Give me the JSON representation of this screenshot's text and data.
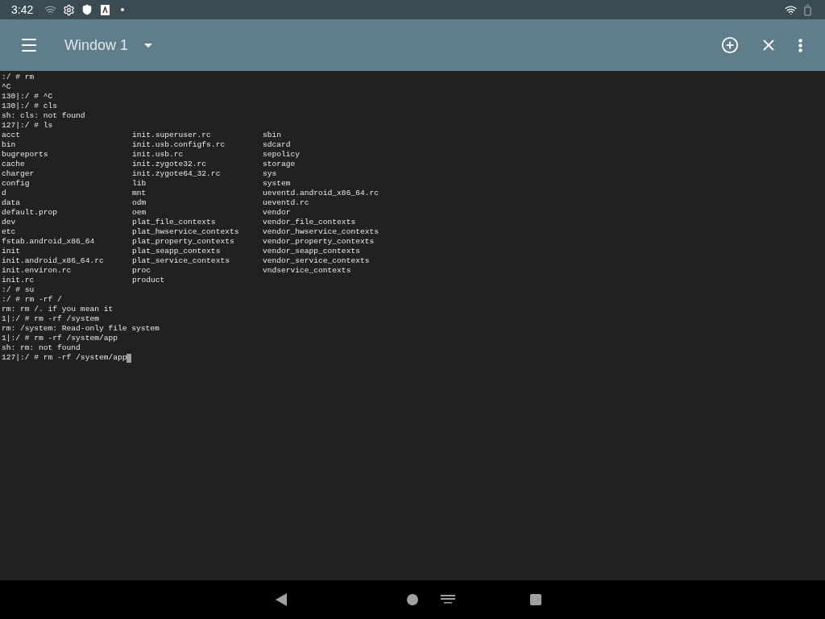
{
  "status_bar": {
    "time": "3:42"
  },
  "toolbar": {
    "title": "Window 1"
  },
  "terminal": {
    "lines_before": [
      ":/ # rm",
      "^C",
      "130|:/ # ^C",
      "130|:/ # cls",
      "sh: cls: not found",
      "127|:/ # ls"
    ],
    "listing": [
      [
        "acct",
        "init.superuser.rc",
        "sbin"
      ],
      [
        "bin",
        "init.usb.configfs.rc",
        "sdcard"
      ],
      [
        "bugreports",
        "init.usb.rc",
        "sepolicy"
      ],
      [
        "cache",
        "init.zygote32.rc",
        "storage"
      ],
      [
        "charger",
        "init.zygote64_32.rc",
        "sys"
      ],
      [
        "config",
        "lib",
        "system"
      ],
      [
        "d",
        "mnt",
        "ueventd.android_x86_64.rc"
      ],
      [
        "data",
        "odm",
        "ueventd.rc"
      ],
      [
        "default.prop",
        "oem",
        "vendor"
      ],
      [
        "dev",
        "plat_file_contexts",
        "vendor_file_contexts"
      ],
      [
        "etc",
        "plat_hwservice_contexts",
        "vendor_hwservice_contexts"
      ],
      [
        "fstab.android_x86_64",
        "plat_property_contexts",
        "vendor_property_contexts"
      ],
      [
        "init",
        "plat_seapp_contexts",
        "vendor_seapp_contexts"
      ],
      [
        "init.android_x86_64.rc",
        "plat_service_contexts",
        "vendor_service_contexts"
      ],
      [
        "init.environ.rc",
        "proc",
        "vndservice_contexts"
      ],
      [
        "init.rc",
        "product"
      ]
    ],
    "lines_after": [
      ":/ # su",
      ":/ # rm -rf /",
      "rm: rm /. if you mean it",
      "1|:/ # rm -rf /system",
      "rm: /system: Read-only file system",
      "1|:/ # rm -rf /system/app",
      "sh: rm: not found",
      "127|:/ # rm -rf /system/app"
    ]
  }
}
